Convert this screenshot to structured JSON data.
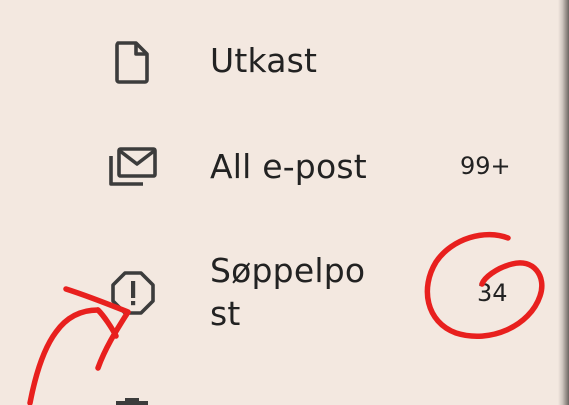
{
  "nav": {
    "items": [
      {
        "label": "Utkast",
        "count": "",
        "icon": "draft-document-icon"
      },
      {
        "label": "All e-post",
        "count": "99+",
        "icon": "all-mail-icon"
      },
      {
        "label_line1": "Søppelpo",
        "label_line2": "st",
        "count": "34",
        "icon": "spam-report-icon"
      },
      {
        "label": "",
        "count": "",
        "icon": "trash-icon"
      }
    ]
  },
  "annotations": {
    "color": "#e8201e",
    "marks": [
      "circle-around-spam-count",
      "arrow-to-spam-icon"
    ]
  },
  "colors": {
    "background": "#f3e8e0",
    "text": "#222222",
    "icon": "#3c3c3c"
  }
}
